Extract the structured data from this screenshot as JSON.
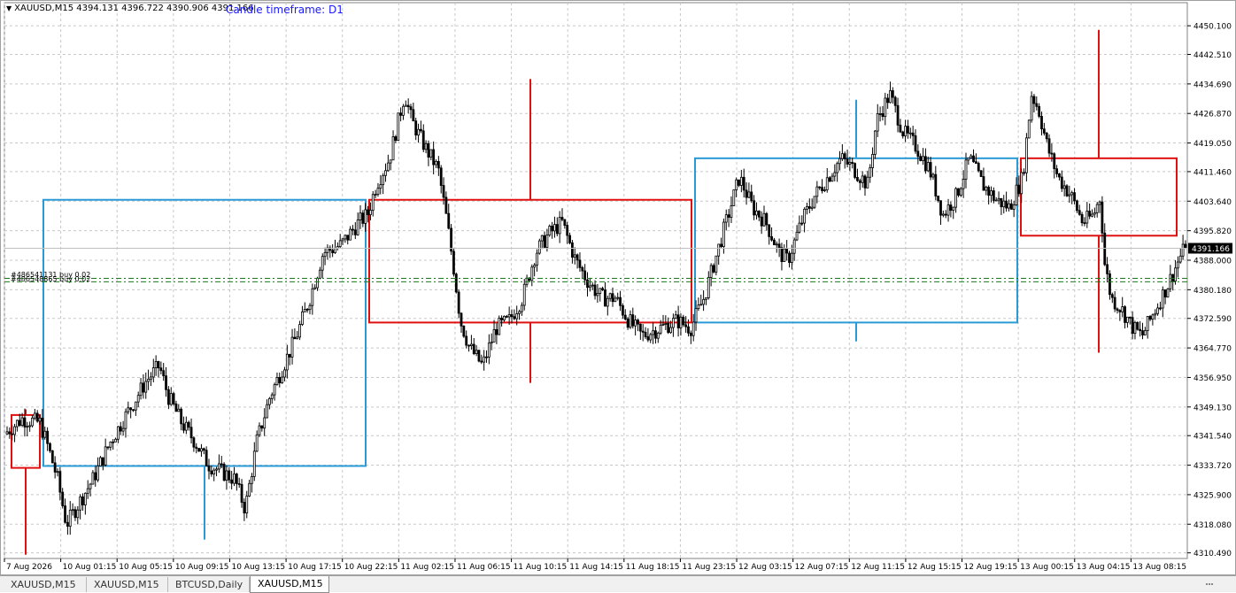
{
  "header": {
    "symbol_info": "XAUUSD,M15  4394.131 4396.722 4390.906 4391.166",
    "timeframe_text": "Candle timeframe: D1"
  },
  "price_axis": {
    "labels": [
      "4450.100",
      "4442.510",
      "4434.690",
      "4426.870",
      "4419.050",
      "4411.460",
      "4403.640",
      "4395.820",
      "4388.000",
      "4380.180",
      "4372.590",
      "4364.770",
      "4356.950",
      "4349.130",
      "4341.540",
      "4333.720",
      "4325.900",
      "4318.080",
      "4310.490"
    ],
    "current_price": "4391.166"
  },
  "time_axis": {
    "labels": [
      "7 Aug 2026",
      "10 Aug 01:15",
      "10 Aug 05:15",
      "10 Aug 09:15",
      "10 Aug 13:15",
      "10 Aug 17:15",
      "10 Aug 22:15",
      "11 Aug 02:15",
      "11 Aug 06:15",
      "11 Aug 10:15",
      "11 Aug 14:15",
      "11 Aug 18:15",
      "11 Aug 23:15",
      "12 Aug 03:15",
      "12 Aug 07:15",
      "12 Aug 11:15",
      "12 Aug 15:15",
      "12 Aug 19:15",
      "13 Aug 00:15",
      "13 Aug 04:15",
      "13 Aug 08:15"
    ]
  },
  "orders": [
    {
      "label": "#486541131 buy 0.02",
      "price": 4383.2
    },
    {
      "label": "#486548865 buy 0.02",
      "price": 4382.3
    }
  ],
  "tabs": [
    {
      "label": "XAUUSD,M15",
      "active": false
    },
    {
      "label": "XAUUSD,M15",
      "active": false
    },
    {
      "label": "BTCUSD,Daily",
      "active": false
    },
    {
      "label": "XAUUSD,M15",
      "active": true
    }
  ],
  "colors": {
    "bull_box": "#2a9ad6",
    "bear_box": "#e01010",
    "candle": "#000000",
    "order_line": "#1a7a1a",
    "grid": "#c8c8c8"
  },
  "chart_data": {
    "type": "candlestick",
    "title": "XAUUSD,M15",
    "ylim": [
      4309.0,
      4452.0
    ],
    "grid": true,
    "daily_candles": [
      {
        "day": "7 Aug 2026",
        "open": 4347.0,
        "close": 4333.0,
        "high": 4348.5,
        "low": 4310.0,
        "direction": "bear"
      },
      {
        "day": "10 Aug",
        "open": 4333.5,
        "close": 4404.0,
        "high": 4404.0,
        "low": 4314.0,
        "direction": "bull"
      },
      {
        "day": "11 Aug",
        "open": 4404.0,
        "close": 4371.5,
        "high": 4436.0,
        "low": 4355.5,
        "direction": "bear"
      },
      {
        "day": "12 Aug",
        "open": 4371.5,
        "close": 4415.0,
        "high": 4430.5,
        "low": 4366.5,
        "direction": "bull"
      },
      {
        "day": "13 Aug",
        "open": 4415.0,
        "close": 4394.5,
        "high": 4449.0,
        "low": 4363.5,
        "direction": "bear"
      }
    ],
    "m15_close_path": [
      [
        0,
        4342
      ],
      [
        20,
        4346
      ],
      [
        40,
        4345
      ],
      [
        50,
        4338
      ],
      [
        60,
        4330
      ],
      [
        70,
        4318
      ],
      [
        80,
        4322
      ],
      [
        100,
        4330
      ],
      [
        120,
        4340
      ],
      [
        140,
        4348
      ],
      [
        160,
        4356
      ],
      [
        175,
        4360
      ],
      [
        185,
        4352
      ],
      [
        200,
        4345
      ],
      [
        215,
        4340
      ],
      [
        230,
        4334
      ],
      [
        245,
        4332
      ],
      [
        260,
        4330
      ],
      [
        272,
        4322
      ],
      [
        285,
        4340
      ],
      [
        300,
        4352
      ],
      [
        315,
        4360
      ],
      [
        330,
        4368
      ],
      [
        345,
        4378
      ],
      [
        360,
        4390
      ],
      [
        380,
        4392
      ],
      [
        400,
        4398
      ],
      [
        410,
        4400
      ],
      [
        420,
        4408
      ],
      [
        435,
        4415
      ],
      [
        445,
        4425
      ],
      [
        452,
        4432
      ],
      [
        460,
        4425
      ],
      [
        475,
        4418
      ],
      [
        490,
        4412
      ],
      [
        500,
        4398
      ],
      [
        508,
        4385
      ],
      [
        515,
        4372
      ],
      [
        525,
        4365
      ],
      [
        540,
        4360
      ],
      [
        555,
        4370
      ],
      [
        570,
        4372
      ],
      [
        585,
        4378
      ],
      [
        600,
        4390
      ],
      [
        615,
        4395
      ],
      [
        630,
        4398
      ],
      [
        645,
        4388
      ],
      [
        660,
        4382
      ],
      [
        675,
        4378
      ],
      [
        690,
        4378
      ],
      [
        705,
        4372
      ],
      [
        720,
        4368
      ],
      [
        740,
        4370
      ],
      [
        760,
        4372
      ],
      [
        775,
        4370
      ],
      [
        790,
        4378
      ],
      [
        800,
        4386
      ],
      [
        815,
        4398
      ],
      [
        830,
        4410
      ],
      [
        845,
        4402
      ],
      [
        860,
        4398
      ],
      [
        875,
        4390
      ],
      [
        885,
        4388
      ],
      [
        900,
        4398
      ],
      [
        915,
        4405
      ],
      [
        930,
        4410
      ],
      [
        945,
        4415
      ],
      [
        960,
        4412
      ],
      [
        975,
        4408
      ],
      [
        985,
        4425
      ],
      [
        1000,
        4432
      ],
      [
        1015,
        4422
      ],
      [
        1030,
        4418
      ],
      [
        1045,
        4412
      ],
      [
        1060,
        4400
      ],
      [
        1075,
        4405
      ],
      [
        1090,
        4415
      ],
      [
        1105,
        4408
      ],
      [
        1120,
        4404
      ],
      [
        1135,
        4402
      ],
      [
        1150,
        4410
      ],
      [
        1160,
        4432
      ],
      [
        1168,
        4428
      ],
      [
        1178,
        4418
      ],
      [
        1190,
        4410
      ],
      [
        1205,
        4405
      ],
      [
        1218,
        4398
      ],
      [
        1230,
        4400
      ],
      [
        1238,
        4405
      ],
      [
        1242,
        4388
      ],
      [
        1250,
        4378
      ],
      [
        1262,
        4375
      ],
      [
        1275,
        4370
      ],
      [
        1285,
        4368
      ],
      [
        1300,
        4375
      ],
      [
        1315,
        4382
      ],
      [
        1330,
        4390
      ],
      [
        1335,
        4391.2
      ]
    ]
  }
}
